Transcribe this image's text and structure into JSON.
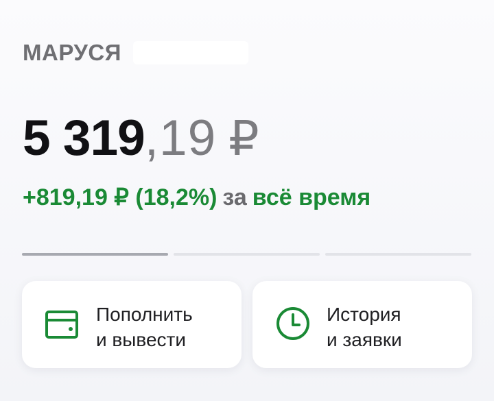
{
  "account": {
    "name": "МАРУСЯ"
  },
  "balance": {
    "integer": "5 319",
    "fraction": ",19",
    "currency": "₽"
  },
  "profit": {
    "value": "+819,19 ₽ (18,2%)",
    "for_word": "за",
    "period": "всё время"
  },
  "pager": {
    "total": 3,
    "active_index": 0
  },
  "actions": [
    {
      "line1": "Пополнить",
      "line2": "и вывести",
      "icon": "wallet-icon"
    },
    {
      "line1": "История",
      "line2": "и заявки",
      "icon": "clock-icon"
    }
  ],
  "colors": {
    "accent_green": "#1a8a35",
    "text_primary": "#111114",
    "text_secondary": "#7c7c80"
  }
}
